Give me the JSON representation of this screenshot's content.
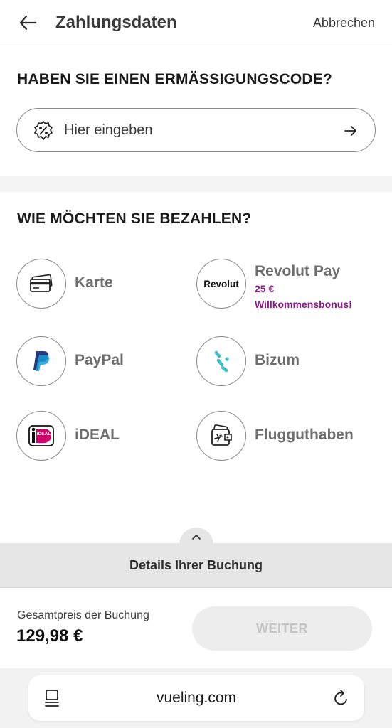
{
  "header": {
    "title": "Zahlungsdaten",
    "cancel_label": "Abbrechen"
  },
  "discount": {
    "heading": "HABEN SIE EINEN ERMÄSSIGUNGSCODE?",
    "placeholder": "Hier eingeben"
  },
  "payment": {
    "heading": "WIE MÖCHTEN SIE BEZAHLEN?",
    "methods": [
      {
        "label": "Karte",
        "icon": "credit-card-icon"
      },
      {
        "label": "Revolut Pay",
        "icon": "revolut-logo",
        "logo_text": "Revolut",
        "bonus_amount": "25 €",
        "bonus_text": "Willkommensbonus!"
      },
      {
        "label": "PayPal",
        "icon": "paypal-logo"
      },
      {
        "label": "Bizum",
        "icon": "bizum-logo"
      },
      {
        "label": "iDEAL",
        "icon": "ideal-logo",
        "logo_text": "iDEAL"
      },
      {
        "label": "Flugguthaben",
        "icon": "wallet-plane-icon"
      }
    ]
  },
  "booking_details": {
    "label": "Details Ihrer Buchung"
  },
  "footer": {
    "total_label": "Gesamtpreis der Buchung",
    "total_value": "129,98 €",
    "continue_label": "WEITER"
  },
  "browser": {
    "url": "vueling.com"
  },
  "colors": {
    "bonus": "#8b1a8b",
    "disabled_button": "#ededed",
    "details_bar": "#e6e6e6",
    "bizum": "#3cbfc4",
    "paypal_dark": "#253b80",
    "paypal_light": "#179bd7",
    "ideal_pink": "#cc0066"
  }
}
